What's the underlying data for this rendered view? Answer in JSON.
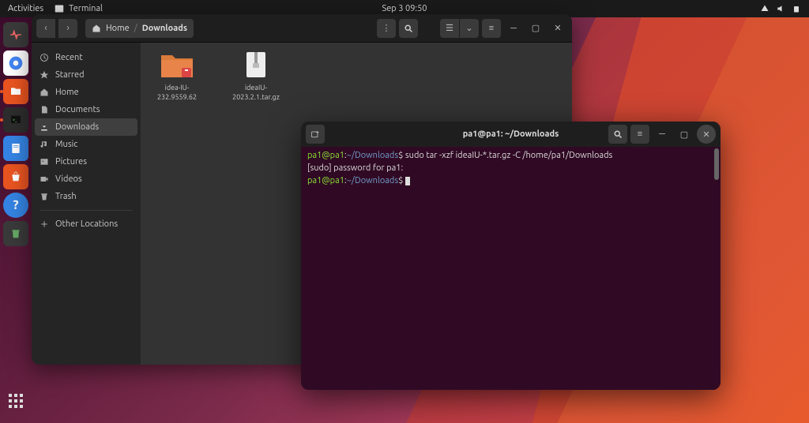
{
  "topbar": {
    "activities": "Activities",
    "app_name": "Terminal",
    "datetime": "Sep 3  09:50"
  },
  "dock": {
    "items": [
      {
        "name": "system-monitor"
      },
      {
        "name": "chrome"
      },
      {
        "name": "files"
      },
      {
        "name": "terminal"
      },
      {
        "name": "text-editor"
      },
      {
        "name": "software-store"
      },
      {
        "name": "help"
      },
      {
        "name": "trash"
      }
    ]
  },
  "files": {
    "breadcrumb_home": "Home",
    "breadcrumb_current": "Downloads",
    "sidebar": [
      {
        "icon": "clock",
        "label": "Recent"
      },
      {
        "icon": "star",
        "label": "Starred"
      },
      {
        "icon": "home",
        "label": "Home"
      },
      {
        "icon": "doc",
        "label": "Documents"
      },
      {
        "icon": "download",
        "label": "Downloads"
      },
      {
        "icon": "music",
        "label": "Music"
      },
      {
        "icon": "picture",
        "label": "Pictures"
      },
      {
        "icon": "video",
        "label": "Videos"
      },
      {
        "icon": "trash",
        "label": "Trash"
      },
      {
        "icon": "plus",
        "label": "Other Locations"
      }
    ],
    "active_index": 4,
    "items": [
      {
        "type": "folder-zip",
        "name": "idea-IU-232.9559.62"
      },
      {
        "type": "archive",
        "name": "ideaIU-2023.2.1.tar.gz"
      }
    ]
  },
  "terminal": {
    "title": "pa1@pa1: ~/Downloads",
    "prompt_user": "pa1@pa1",
    "prompt_path": "~/Downloads",
    "lines": [
      {
        "type": "cmd",
        "text": "sudo tar -xzf ideaIU-*.tar.gz -C /home/pa1/Downloads"
      },
      {
        "type": "out",
        "text": "[sudo] password for pa1:"
      },
      {
        "type": "cmd",
        "text": ""
      }
    ]
  }
}
